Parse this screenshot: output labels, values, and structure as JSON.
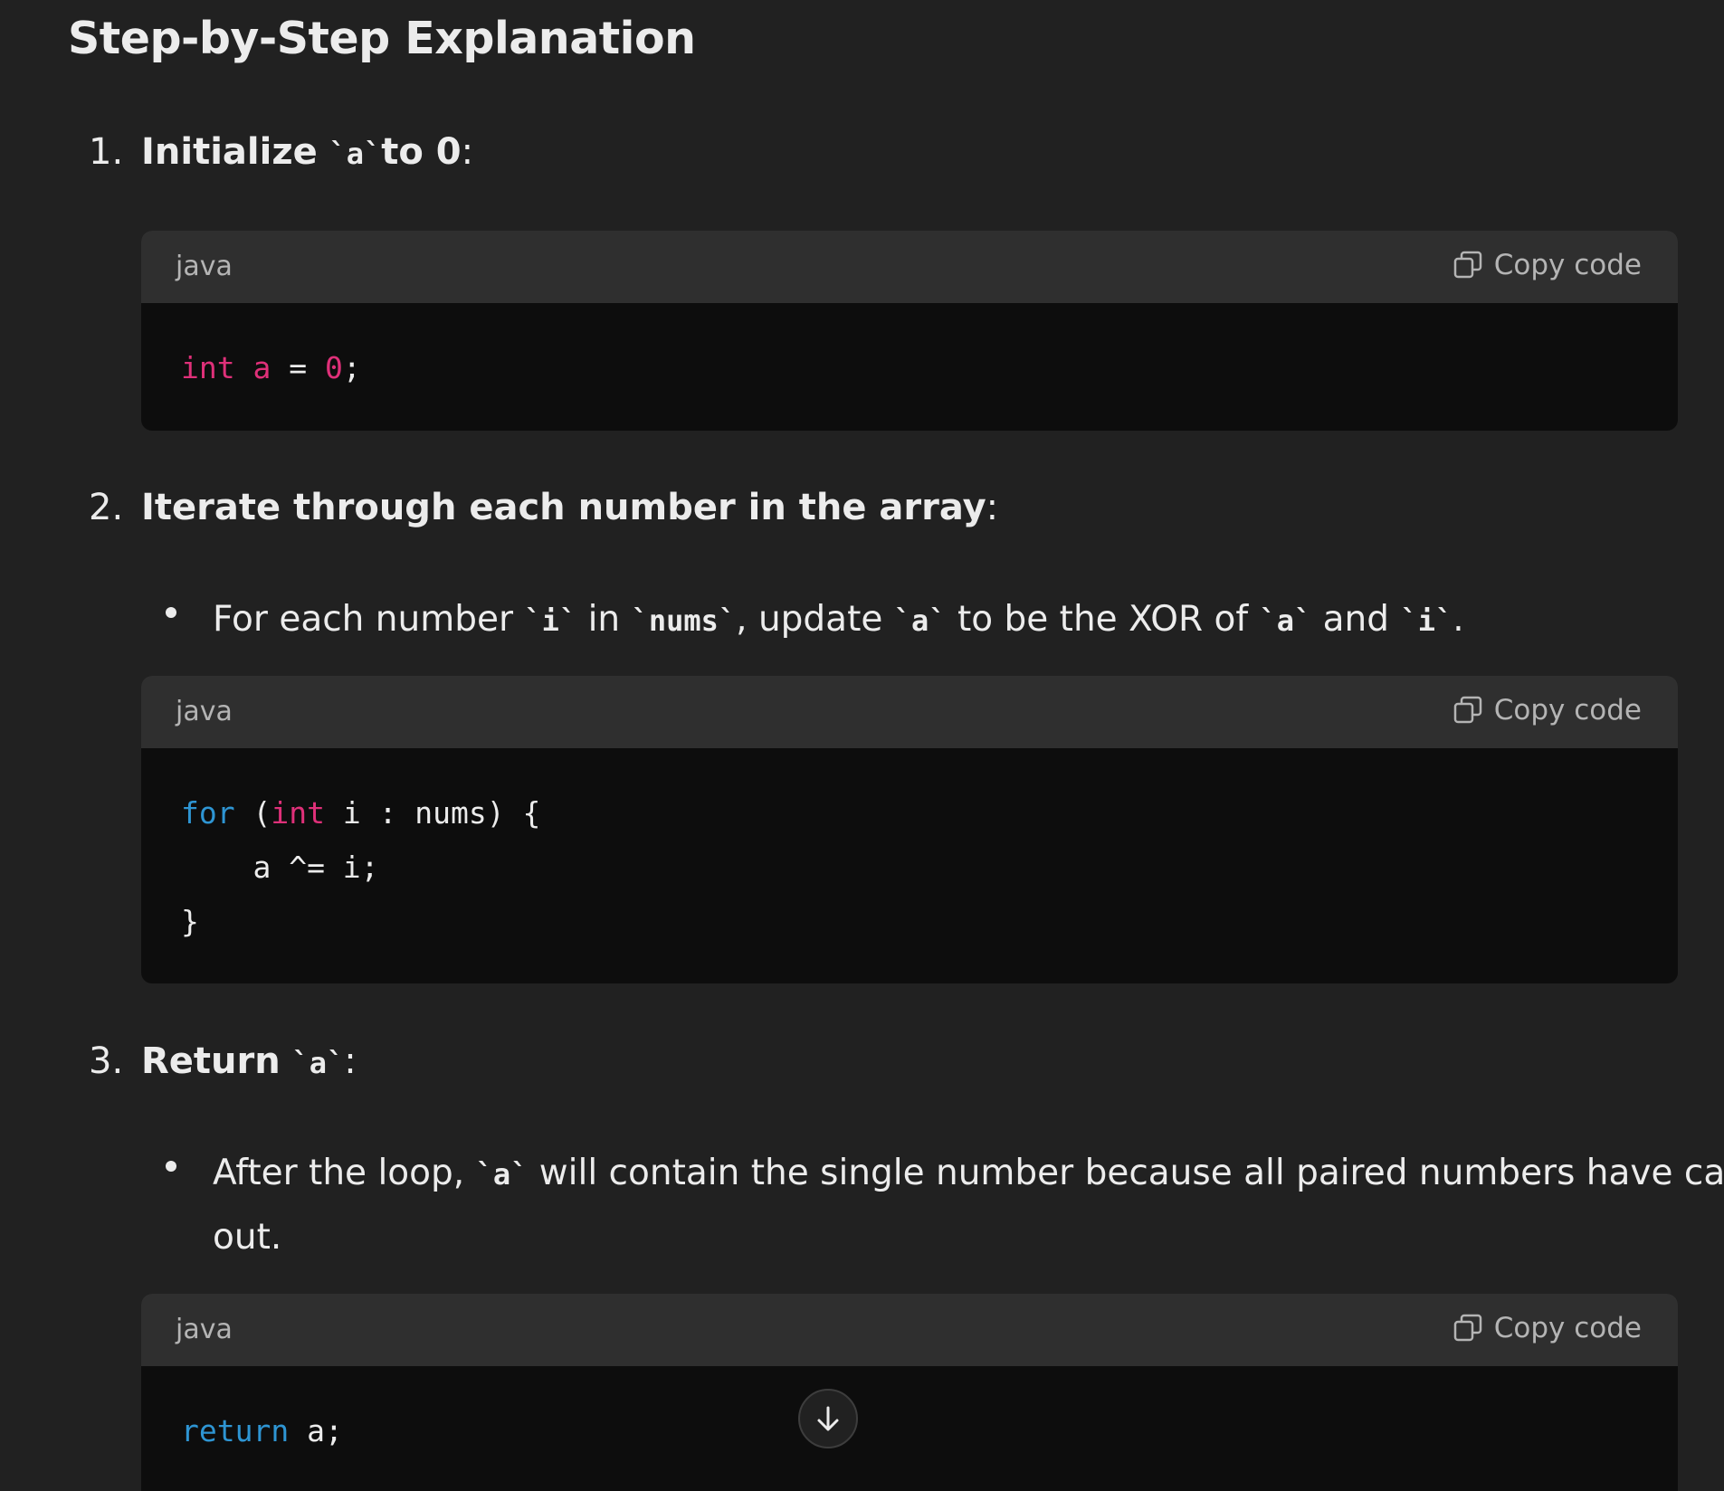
{
  "heading": "Step-by-Step Explanation",
  "steps": [
    {
      "number": "1.",
      "text_bold": "Initialize",
      "code": "`a`",
      "text_bold_after": " to 0",
      "suffix": ":"
    },
    {
      "number": "2.",
      "text_bold": "Iterate through each number in the array",
      "suffix": ":"
    },
    {
      "number": "3.",
      "text_bold": "Return",
      "code": "`a`",
      "suffix": ":"
    }
  ],
  "bullets": [
    {
      "parts": [
        "For each number ",
        "`i`",
        " in ",
        "`nums`",
        ", update ",
        "`a`",
        " to be the XOR of ",
        "`a`",
        " and ",
        "`i`",
        "."
      ]
    },
    {
      "line1_parts": [
        "After the loop, ",
        "`a`",
        " will contain the single number because all paired numbers have canceled"
      ],
      "line2": "out."
    }
  ],
  "code_blocks": [
    {
      "language": "java",
      "copy_label": "Copy code",
      "lines": [
        [
          {
            "t": "int",
            "c": "pink"
          },
          {
            "t": " ",
            "c": ""
          },
          {
            "t": "a",
            "c": "pink"
          },
          {
            "t": " = ",
            "c": ""
          },
          {
            "t": "0",
            "c": "pink"
          },
          {
            "t": ";",
            "c": ""
          }
        ]
      ]
    },
    {
      "language": "java",
      "copy_label": "Copy code",
      "lines": [
        [
          {
            "t": "for",
            "c": "blue"
          },
          {
            "t": " (",
            "c": ""
          },
          {
            "t": "int",
            "c": "pink"
          },
          {
            "t": " i : nums) {",
            "c": ""
          }
        ],
        [
          {
            "t": "    a ^= i;",
            "c": ""
          }
        ],
        [
          {
            "t": "}",
            "c": ""
          }
        ]
      ]
    },
    {
      "language": "java",
      "copy_label": "Copy code",
      "lines": [
        [
          {
            "t": "return",
            "c": "blue"
          },
          {
            "t": " a;",
            "c": ""
          }
        ]
      ]
    }
  ],
  "icons": {
    "copy": "copy-icon",
    "scroll": "arrow-down-icon"
  }
}
